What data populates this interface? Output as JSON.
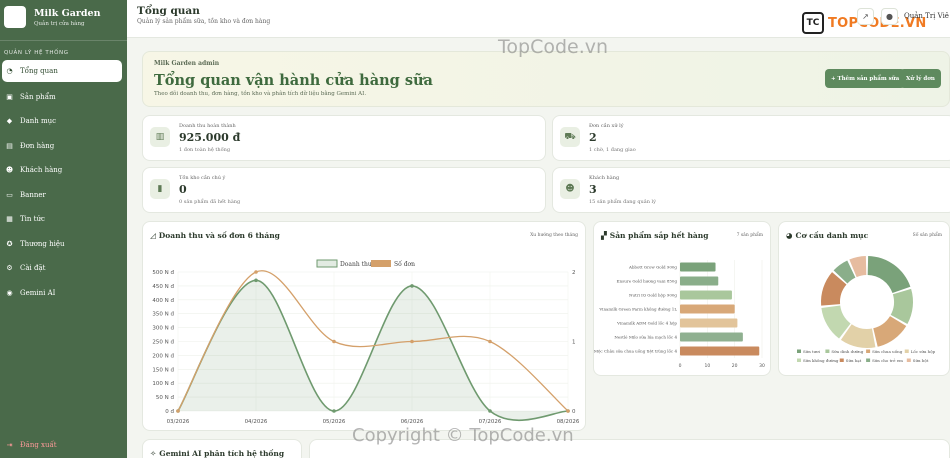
{
  "brand": {
    "name": "Milk Garden",
    "subtitle": "Quản trị cửa hàng"
  },
  "sidebar": {
    "section_label": "QUẢN LÝ HỆ THỐNG",
    "items": [
      {
        "label": "Tổng quan",
        "icon": "gauge-icon",
        "glyph": "◔",
        "active": true
      },
      {
        "label": "Sản phẩm",
        "icon": "box-icon",
        "glyph": "▣"
      },
      {
        "label": "Danh mục",
        "icon": "tags-icon",
        "glyph": "◆"
      },
      {
        "label": "Đơn hàng",
        "icon": "cart-icon",
        "glyph": "▤"
      },
      {
        "label": "Khách hàng",
        "icon": "users-icon",
        "glyph": "☻"
      },
      {
        "label": "Banner",
        "icon": "image-icon",
        "glyph": "▭"
      },
      {
        "label": "Tin tức",
        "icon": "news-icon",
        "glyph": "▦"
      },
      {
        "label": "Thương hiệu",
        "icon": "award-icon",
        "glyph": "✪"
      },
      {
        "label": "Cài đặt",
        "icon": "gear-icon",
        "glyph": "⚙"
      },
      {
        "label": "Gemini AI",
        "icon": "robot-icon",
        "glyph": "◉"
      }
    ],
    "logout_label": "Đăng xuất"
  },
  "topbar": {
    "title": "Tổng quan",
    "subtitle": "Quản lý sản phẩm sữa, tồn kho và đơn hàng",
    "user_name": "Quản Trị Viê",
    "logo_text": "TOPCODE.VN",
    "logo_mark": "TC"
  },
  "hero": {
    "kicker": "Milk Garden admin",
    "title": "Tổng quan vận hành cửa hàng sữa",
    "description": "Theo dõi doanh thu, đơn hàng, tồn kho và phân tích dữ liệu bằng Gemini AI.",
    "add_button": "+ Thêm sản phẩm sữa",
    "orders_button": "Xử lý đơn"
  },
  "stats": [
    {
      "label": "Doanh thu hoàn thành",
      "value": "925.000 đ",
      "note": "1 đơn toàn hệ thống",
      "icon": "money-icon",
      "glyph": "▥"
    },
    {
      "label": "Đơn cần xử lý",
      "value": "2",
      "note": "1 chờ, 1 đang giao",
      "icon": "truck-icon",
      "glyph": "⛟"
    },
    {
      "label": "Tồn kho cần chú ý",
      "value": "0",
      "note": "0 sản phẩm đã hết hàng",
      "icon": "bottle-icon",
      "glyph": "▮"
    },
    {
      "label": "Khách hàng",
      "value": "3",
      "note": "15 sản phẩm đang quản lý",
      "icon": "customers-icon",
      "glyph": "☻"
    }
  ],
  "panels": {
    "revenue": {
      "title": "Doanh thu và số đơn 6 tháng",
      "meta": "Xu hướng theo tháng",
      "icon": "line-chart-icon",
      "glyph": "◿"
    },
    "low_stock": {
      "title": "Sản phẩm sắp hết hàng",
      "meta": "7 sản phẩm",
      "icon": "cubes-icon",
      "glyph": "▞"
    },
    "category": {
      "title": "Cơ cấu danh mục",
      "meta": "Số sản phẩm",
      "icon": "pie-icon",
      "glyph": "◕"
    },
    "gemini": {
      "title": "Gemini AI phân tích hệ thống",
      "icon": "magic-icon",
      "glyph": "✧"
    }
  },
  "watermark": "Copyright © TopCode.vn",
  "watermark_top": "TopCode.vn",
  "colors": {
    "accent": "#4a6a4a",
    "revenue": "#6f9a6f",
    "orders": "#d4a06a"
  },
  "chart_data": [
    {
      "type": "line",
      "x": [
        "03/2026",
        "04/2026",
        "05/2026",
        "06/2026",
        "07/2026",
        "08/2026"
      ],
      "yticks_left": [
        "0 đ",
        "50 N đ",
        "100 N đ",
        "150 N đ",
        "200 N đ",
        "250 N đ",
        "300 N đ",
        "350 N đ",
        "400 N đ",
        "450 N đ",
        "500 N đ"
      ],
      "ylim_left": [
        0,
        500000
      ],
      "ylim_right": [
        0,
        2
      ],
      "yticks_right": [
        "0",
        "1",
        "2"
      ],
      "series": [
        {
          "name": "Doanh thu",
          "values": [
            0,
            470000,
            0,
            450000,
            0,
            0
          ],
          "color": "#6f9a6f"
        },
        {
          "name": "Số đơn",
          "values": [
            0,
            2,
            1,
            1,
            1,
            0
          ],
          "color": "#d4a06a"
        }
      ],
      "legend": "top"
    },
    {
      "type": "bar",
      "orientation": "horizontal",
      "categories": [
        "Abbott Grow Gold 900g",
        "Ensure Gold hương vani 850g",
        "Nutri IQ Gold hộp 900g",
        "Vinamilk Green Farm không đường 1L",
        "Vinamilk ADM Gold lốc 4 hộp",
        "Nestlé Milo sữa lúa mạch lốc 4",
        "Mộc Châu sữa chua uống tiệt trùng lốc 4"
      ],
      "values": [
        13,
        14,
        19,
        20,
        21,
        23,
        29
      ],
      "colors": [
        "#7aa27a",
        "#8aae8a",
        "#a9c79c",
        "#d8a878",
        "#e2c49a",
        "#8fb090",
        "#c98a5e"
      ],
      "xlim": [
        0,
        30
      ],
      "xticks": [
        "0",
        "10",
        "20",
        "30"
      ]
    },
    {
      "type": "pie",
      "donut": true,
      "categories": [
        "Sữa tươi",
        "Sữa dinh dưỡng",
        "Sữa chua uống",
        "Lốc sữa hộp",
        "Sữa không đường",
        "Sữa hạt",
        "Sữa cho trẻ em",
        "Sữa bột"
      ],
      "values": [
        3,
        2,
        2,
        2,
        2,
        2,
        1,
        1
      ],
      "colors": [
        "#7aa27a",
        "#a9c79c",
        "#d8a878",
        "#e2d1a8",
        "#c2d8b0",
        "#c98a5e",
        "#8aae8a",
        "#e6bca0"
      ],
      "legend": "bottom"
    }
  ]
}
